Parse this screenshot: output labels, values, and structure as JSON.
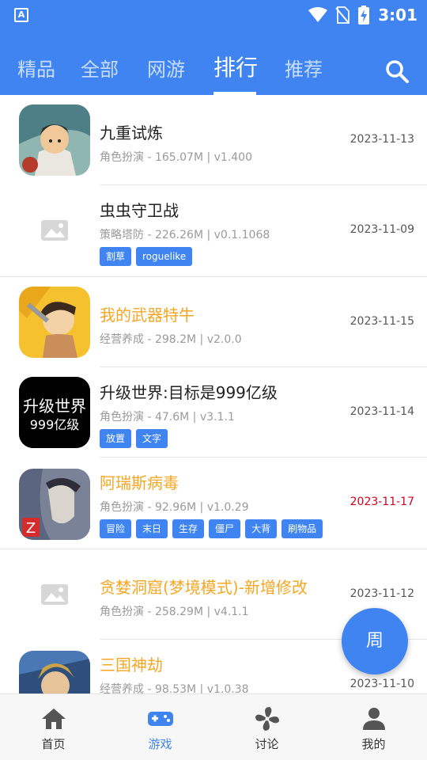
{
  "status_bar": {
    "time": "3:01",
    "app_glyph": "A"
  },
  "tabs": [
    {
      "label": "精品"
    },
    {
      "label": "全部"
    },
    {
      "label": "网游"
    },
    {
      "label": "排行"
    },
    {
      "label": "推荐"
    }
  ],
  "active_tab": "排行",
  "games": [
    {
      "title": "九重试炼",
      "meta": "角色扮演 - 165.07M | v1.400",
      "date": "2023-11-13",
      "tags": [],
      "icon": "jiuzhong-icon"
    },
    {
      "title": "虫虫守卫战",
      "meta": "策略塔防 - 226.26M | v0.1.1068",
      "date": "2023-11-09",
      "tags": [
        "割草",
        "roguelike"
      ],
      "icon": "image-placeholder-icon"
    },
    {
      "title": "我的武器特牛",
      "meta": "经营养成 - 298.2M | v2.0.0",
      "date": "2023-11-15",
      "tags": [],
      "icon": "weapon-game-icon"
    },
    {
      "title": "升级世界:目标是999亿级",
      "meta": "角色扮演 - 47.6M | v3.1.1",
      "date": "2023-11-14",
      "tags": [
        "放置",
        "文字"
      ],
      "icon": "shengji-icon",
      "icon_text_line1": "升级世界",
      "icon_text_line2": "999亿级"
    },
    {
      "title": "阿瑞斯病毒",
      "meta": "角色扮演 - 92.96M | v1.0.29",
      "date": "2023-11-17",
      "tags": [
        "冒险",
        "末日",
        "生存",
        "僵尸",
        "大背",
        "刷物品"
      ],
      "icon": "ares-virus-icon"
    },
    {
      "title": "贪婪洞窟(梦境模式)-新增修改",
      "meta": "角色扮演 - 258.29M | v4.1.1",
      "date": "2023-11-12",
      "tags": [],
      "icon": "image-placeholder-icon"
    },
    {
      "title": "三国神劫",
      "meta": "经营养成 - 98.53M | v1.0.38",
      "date": "2023-11-10",
      "tags": [],
      "icon": "sanguo-icon"
    }
  ],
  "colors": {
    "primary": "#3f84f0",
    "highlight_title": "#f5a623",
    "red_date": "#d0021b"
  },
  "fab": {
    "label": "周"
  },
  "bottom_nav": [
    {
      "label": "首页",
      "icon": "home-icon"
    },
    {
      "label": "游戏",
      "icon": "gamepad-icon"
    },
    {
      "label": "讨论",
      "icon": "pinwheel-icon"
    },
    {
      "label": "我的",
      "icon": "person-icon"
    }
  ],
  "active_nav": "游戏"
}
